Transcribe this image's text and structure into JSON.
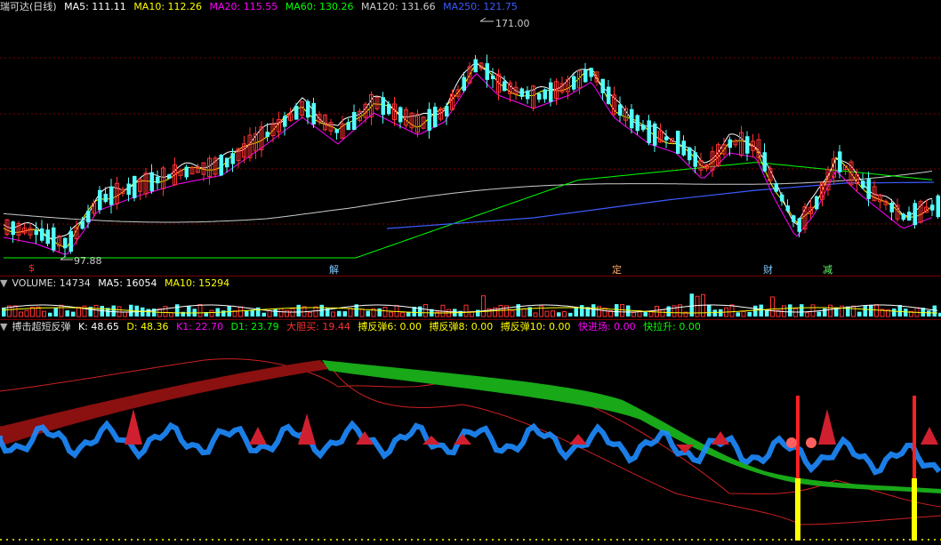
{
  "main": {
    "title": "瑞可达(日线)",
    "ma_labels": [
      {
        "text": "MA5: 111.11",
        "color": "#ffffff"
      },
      {
        "text": "MA10: 112.26",
        "color": "#ffff00"
      },
      {
        "text": "MA20: 115.55",
        "color": "#ff00ff"
      },
      {
        "text": "MA60: 130.26",
        "color": "#00ff00"
      },
      {
        "text": "MA120: 131.66",
        "color": "#cccccc"
      },
      {
        "text": "MA250: 121.75",
        "color": "#3b5bff"
      }
    ],
    "high_label": "171.00",
    "low_label": "97.88",
    "events": [
      {
        "text": "$",
        "color": "#ff3030"
      },
      {
        "text": "解",
        "color": "#7fc8ff"
      },
      {
        "text": "定",
        "color": "#ffaa66"
      },
      {
        "text": "财",
        "color": "#7fc8ff"
      },
      {
        "text": "减",
        "color": "#66ff66"
      }
    ]
  },
  "volume": {
    "labels": [
      {
        "text": "VOLUME: 14734",
        "color": "#dddddd"
      },
      {
        "text": "MA5: 16054",
        "color": "#ffffff"
      },
      {
        "text": "MA10: 15294",
        "color": "#ffff00"
      }
    ]
  },
  "indicator": {
    "labels": [
      {
        "text": "搏击超短反弹",
        "color": "#dddddd"
      },
      {
        "text": "K: 48.65",
        "color": "#ffffff"
      },
      {
        "text": "D: 48.36",
        "color": "#ffff00"
      },
      {
        "text": "K1: 22.70",
        "color": "#ff00ff"
      },
      {
        "text": "D1: 23.79",
        "color": "#00ff00"
      },
      {
        "text": "大胆买: 19.44",
        "color": "#ff3030"
      },
      {
        "text": "搏反弹6: 0.00",
        "color": "#ffff00"
      },
      {
        "text": "搏反弹8: 0.00",
        "color": "#ffff00"
      },
      {
        "text": "搏反弹10: 0.00",
        "color": "#ffff00"
      },
      {
        "text": "快进场: 0.00",
        "color": "#ff00ff"
      },
      {
        "text": "快拉升: 0.00",
        "color": "#00ff00"
      }
    ]
  },
  "colors": {
    "up": "#ff3232",
    "down": "#54ffff",
    "grid": "#7a0000"
  }
}
